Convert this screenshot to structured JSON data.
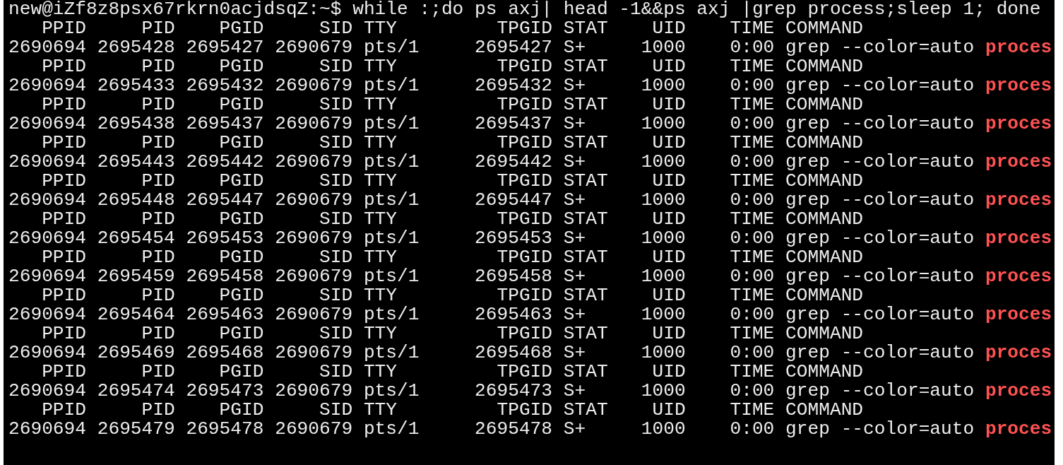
{
  "terminal": {
    "prompt": "new@iZf8z8psx67rkrn0acjdsqZ:~$",
    "command": "while :;do ps axj| head -1&&ps axj |grep process;sleep 1; done",
    "lines": [
      {
        "kind": "header",
        "cells": [
          "PPID",
          "PID",
          "PGID",
          "SID",
          "TTY",
          "TPGID",
          "STAT",
          "UID",
          "TIME",
          "COMMAND"
        ]
      },
      {
        "kind": "process",
        "cells": [
          "2690694",
          "2695428",
          "2695427",
          "2690679",
          "pts/1",
          "2695427",
          "S+",
          "1000",
          "0:00",
          "grep --color=auto"
        ],
        "match": "proces"
      },
      {
        "kind": "header",
        "cells": [
          "PPID",
          "PID",
          "PGID",
          "SID",
          "TTY",
          "TPGID",
          "STAT",
          "UID",
          "TIME",
          "COMMAND"
        ]
      },
      {
        "kind": "process",
        "cells": [
          "2690694",
          "2695433",
          "2695432",
          "2690679",
          "pts/1",
          "2695432",
          "S+",
          "1000",
          "0:00",
          "grep --color=auto"
        ],
        "match": "proces"
      },
      {
        "kind": "header",
        "cells": [
          "PPID",
          "PID",
          "PGID",
          "SID",
          "TTY",
          "TPGID",
          "STAT",
          "UID",
          "TIME",
          "COMMAND"
        ]
      },
      {
        "kind": "process",
        "cells": [
          "2690694",
          "2695438",
          "2695437",
          "2690679",
          "pts/1",
          "2695437",
          "S+",
          "1000",
          "0:00",
          "grep --color=auto"
        ],
        "match": "proces"
      },
      {
        "kind": "header",
        "cells": [
          "PPID",
          "PID",
          "PGID",
          "SID",
          "TTY",
          "TPGID",
          "STAT",
          "UID",
          "TIME",
          "COMMAND"
        ]
      },
      {
        "kind": "process",
        "cells": [
          "2690694",
          "2695443",
          "2695442",
          "2690679",
          "pts/1",
          "2695442",
          "S+",
          "1000",
          "0:00",
          "grep --color=auto"
        ],
        "match": "proces"
      },
      {
        "kind": "header",
        "cells": [
          "PPID",
          "PID",
          "PGID",
          "SID",
          "TTY",
          "TPGID",
          "STAT",
          "UID",
          "TIME",
          "COMMAND"
        ]
      },
      {
        "kind": "process",
        "cells": [
          "2690694",
          "2695448",
          "2695447",
          "2690679",
          "pts/1",
          "2695447",
          "S+",
          "1000",
          "0:00",
          "grep --color=auto"
        ],
        "match": "proces"
      },
      {
        "kind": "header",
        "cells": [
          "PPID",
          "PID",
          "PGID",
          "SID",
          "TTY",
          "TPGID",
          "STAT",
          "UID",
          "TIME",
          "COMMAND"
        ]
      },
      {
        "kind": "process",
        "cells": [
          "2690694",
          "2695454",
          "2695453",
          "2690679",
          "pts/1",
          "2695453",
          "S+",
          "1000",
          "0:00",
          "grep --color=auto"
        ],
        "match": "proces"
      },
      {
        "kind": "header",
        "cells": [
          "PPID",
          "PID",
          "PGID",
          "SID",
          "TTY",
          "TPGID",
          "STAT",
          "UID",
          "TIME",
          "COMMAND"
        ]
      },
      {
        "kind": "process",
        "cells": [
          "2690694",
          "2695459",
          "2695458",
          "2690679",
          "pts/1",
          "2695458",
          "S+",
          "1000",
          "0:00",
          "grep --color=auto"
        ],
        "match": "proces"
      },
      {
        "kind": "header",
        "cells": [
          "PPID",
          "PID",
          "PGID",
          "SID",
          "TTY",
          "TPGID",
          "STAT",
          "UID",
          "TIME",
          "COMMAND"
        ]
      },
      {
        "kind": "process",
        "cells": [
          "2690694",
          "2695464",
          "2695463",
          "2690679",
          "pts/1",
          "2695463",
          "S+",
          "1000",
          "0:00",
          "grep --color=auto"
        ],
        "match": "proces"
      },
      {
        "kind": "header",
        "cells": [
          "PPID",
          "PID",
          "PGID",
          "SID",
          "TTY",
          "TPGID",
          "STAT",
          "UID",
          "TIME",
          "COMMAND"
        ]
      },
      {
        "kind": "process",
        "cells": [
          "2690694",
          "2695469",
          "2695468",
          "2690679",
          "pts/1",
          "2695468",
          "S+",
          "1000",
          "0:00",
          "grep --color=auto"
        ],
        "match": "proces"
      },
      {
        "kind": "header",
        "cells": [
          "PPID",
          "PID",
          "PGID",
          "SID",
          "TTY",
          "TPGID",
          "STAT",
          "UID",
          "TIME",
          "COMMAND"
        ]
      },
      {
        "kind": "process",
        "cells": [
          "2690694",
          "2695474",
          "2695473",
          "2690679",
          "pts/1",
          "2695473",
          "S+",
          "1000",
          "0:00",
          "grep --color=auto"
        ],
        "match": "proces"
      },
      {
        "kind": "header",
        "cells": [
          "PPID",
          "PID",
          "PGID",
          "SID",
          "TTY",
          "TPGID",
          "STAT",
          "UID",
          "TIME",
          "COMMAND"
        ]
      },
      {
        "kind": "process",
        "cells": [
          "2690694",
          "2695479",
          "2695478",
          "2690679",
          "pts/1",
          "2695478",
          "S+",
          "1000",
          "0:00",
          "grep --color=auto"
        ],
        "match": "proces"
      }
    ]
  }
}
